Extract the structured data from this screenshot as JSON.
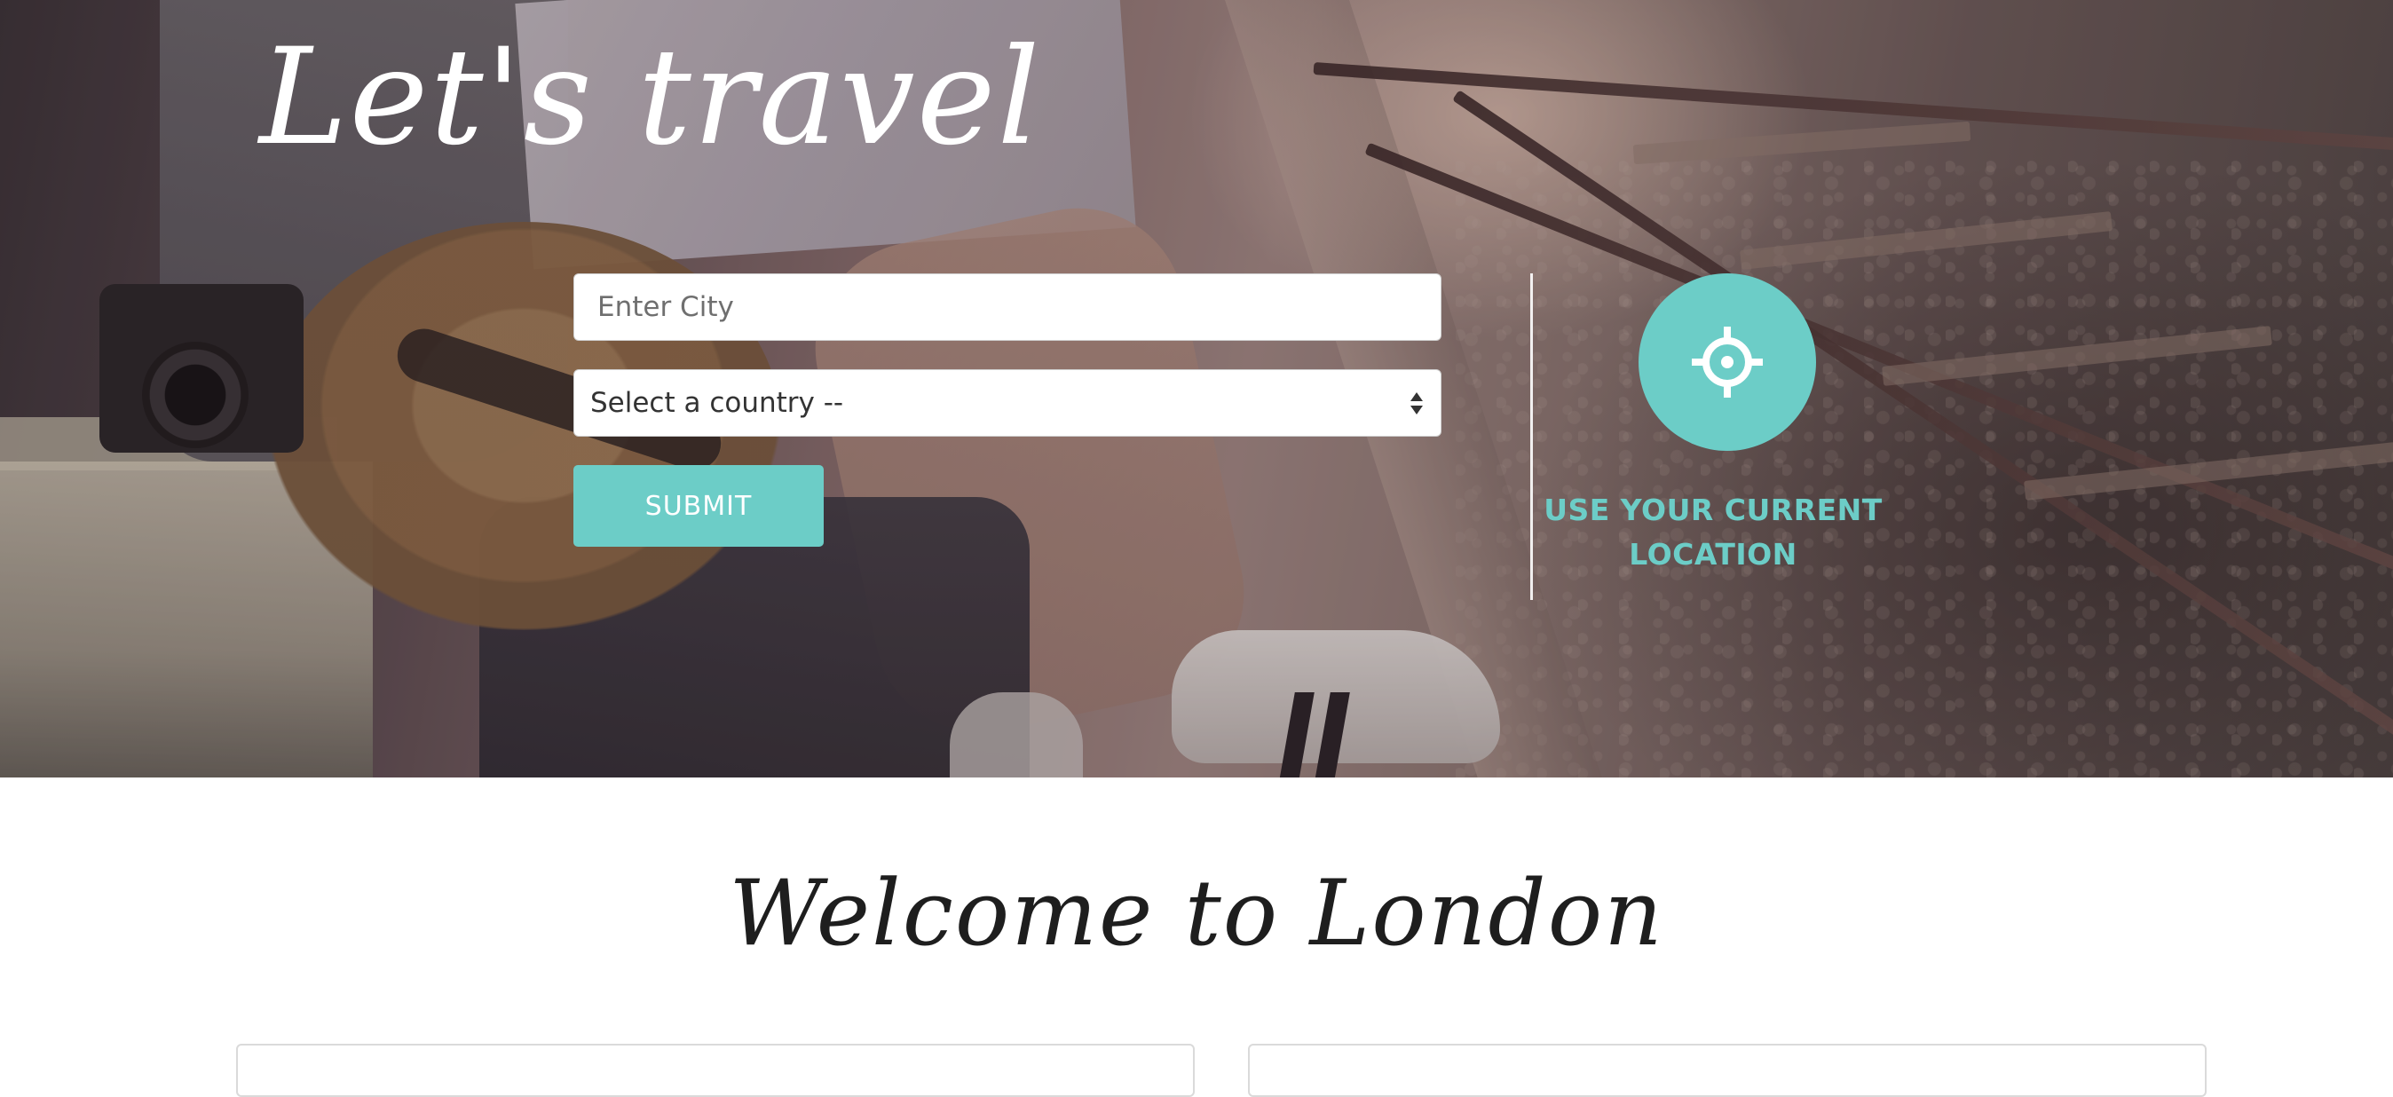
{
  "hero": {
    "title": "Let's travel",
    "city_input": {
      "value": "",
      "placeholder": "Enter City"
    },
    "country_select": {
      "selected": "Select a country --"
    },
    "submit_label": "SUBMIT",
    "location": {
      "icon": "crosshair-icon",
      "label": "USE YOUR CURRENT LOCATION"
    }
  },
  "main": {
    "welcome_heading": "Welcome to London"
  },
  "colors": {
    "accent": "#6ccdc7",
    "heading_text": "#1e1e1e",
    "hero_text": "#ffffff"
  }
}
